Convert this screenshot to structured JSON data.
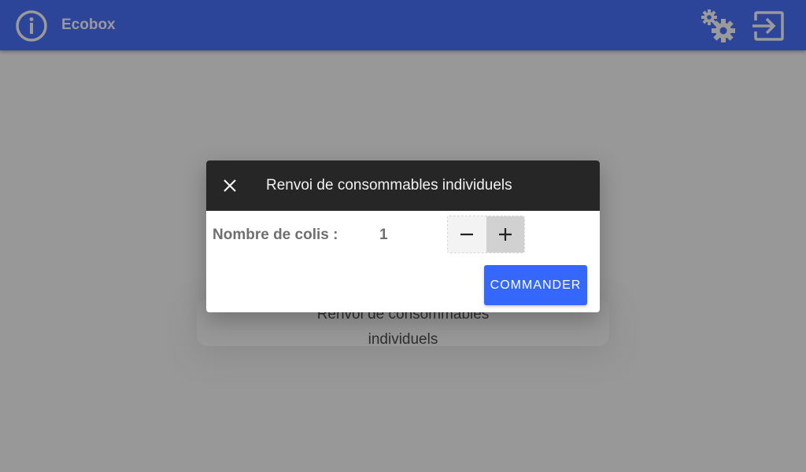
{
  "appbar": {
    "title": "Ecobox",
    "left_icon": "info-icon",
    "right_icons": [
      "gears-icon",
      "logout-icon"
    ],
    "background_color": "#2d4599"
  },
  "background": {
    "card_label_line1": "Renvoi de consommables",
    "card_label_line2": "individuels"
  },
  "dialog": {
    "title": "Renvoi de consommables individuels",
    "close_icon": "close-icon",
    "quantity_label": "Nombre de colis :",
    "quantity_value": "1",
    "decrement_icon": "minus-icon",
    "increment_icon": "plus-icon",
    "submit_label": "COMMANDER",
    "submit_color": "#3567fb",
    "header_color": "#262626"
  }
}
